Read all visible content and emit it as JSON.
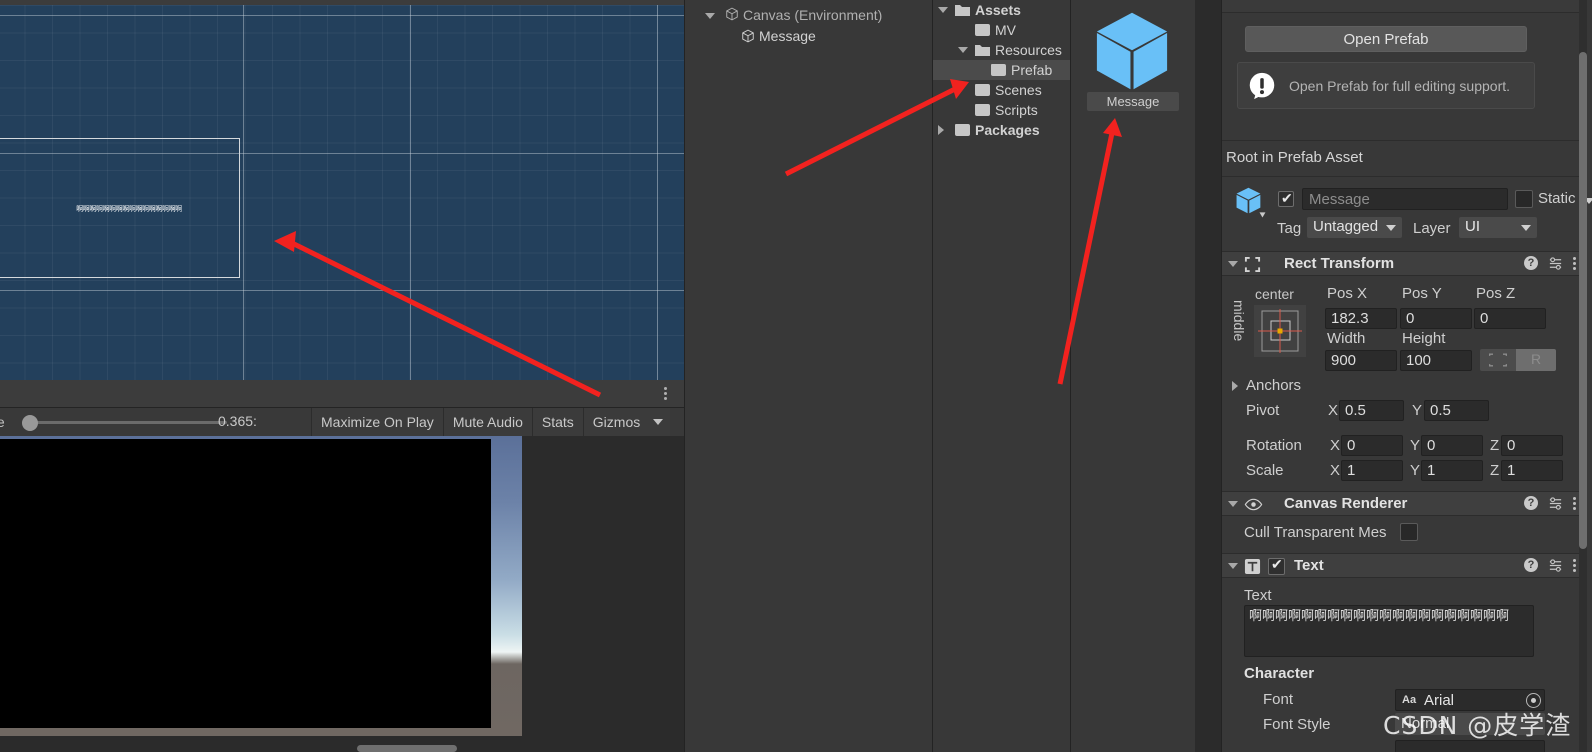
{
  "scene_view": {
    "canvas_text": "啊啊啊啊啊啊啊啊啊啊啊啊啊啊啊啊"
  },
  "game_toolbar": {
    "scale_label": "ale",
    "scale_value": "0.365:",
    "maximize_on_play": "Maximize On Play",
    "mute_audio": "Mute Audio",
    "stats": "Stats",
    "gizmos": "Gizmos"
  },
  "hierarchy": {
    "items": [
      {
        "label": "Canvas (Environment)",
        "icon": "cube-outline-icon"
      },
      {
        "label": "Message",
        "icon": "cube-outline-icon"
      }
    ]
  },
  "project": {
    "items": [
      {
        "label": "Assets",
        "icon": "folder-open-icon",
        "bold": true,
        "indent": 22,
        "expanded": true,
        "selected": false
      },
      {
        "label": "MV",
        "icon": "folder-icon",
        "bold": false,
        "indent": 42,
        "expanded": null,
        "selected": false
      },
      {
        "label": "Resources",
        "icon": "folder-open-icon",
        "bold": false,
        "indent": 42,
        "expanded": true,
        "selected": false
      },
      {
        "label": "Prefab",
        "icon": "folder-icon",
        "bold": false,
        "indent": 58,
        "expanded": null,
        "selected": true
      },
      {
        "label": "Scenes",
        "icon": "folder-icon",
        "bold": false,
        "indent": 42,
        "expanded": null,
        "selected": false
      },
      {
        "label": "Scripts",
        "icon": "folder-icon",
        "bold": false,
        "indent": 42,
        "expanded": null,
        "selected": false
      },
      {
        "label": "Packages",
        "icon": "folder-icon",
        "bold": true,
        "indent": 22,
        "expanded": false,
        "selected": false
      }
    ]
  },
  "preview": {
    "asset_name": "Message",
    "icon": "prefab-cube-icon"
  },
  "inspector": {
    "open_prefab_button": "Open Prefab",
    "prefab_help": "Open Prefab for full editing support.",
    "root_label": "Root in Prefab Asset",
    "game_object": {
      "name_placeholder": "Message",
      "static_label": "Static",
      "tag_label": "Tag",
      "tag_value": "Untagged",
      "layer_label": "Layer",
      "layer_value": "UI"
    },
    "rect_transform": {
      "title": "Rect Transform",
      "anchor_h": "center",
      "anchor_v": "middle",
      "pos_x_label": "Pos X",
      "pos_x": "182.3",
      "pos_y_label": "Pos Y",
      "pos_y": "0",
      "pos_z_label": "Pos Z",
      "pos_z": "0",
      "width_label": "Width",
      "width": "900",
      "height_label": "Height",
      "height": "100",
      "raw_button": "R",
      "anchors_label": "Anchors",
      "pivot_label": "Pivot",
      "pivot_x": "0.5",
      "pivot_y": "0.5",
      "rotation_label": "Rotation",
      "rot_x": "0",
      "rot_y": "0",
      "rot_z": "0",
      "scale_label": "Scale",
      "scale_x": "1",
      "scale_y": "1",
      "scale_z": "1",
      "axis_x": "X",
      "axis_y": "Y",
      "axis_z": "Z"
    },
    "canvas_renderer": {
      "title": "Canvas Renderer",
      "cull_label": "Cull Transparent Mes"
    },
    "text_component": {
      "title": "Text",
      "text_label": "Text",
      "text_value": "啊啊啊啊啊啊啊啊啊啊啊啊啊啊啊啊啊啊啊啊",
      "character_label": "Character",
      "font_label": "Font",
      "font_value": "Arial",
      "font_style_label": "Font Style",
      "font_style_value": "Normal"
    }
  },
  "watermark": "CSDN @皮学渣",
  "colors": {
    "scene_bg": "#23405c",
    "panel_bg": "#383838",
    "arrow_red": "#f2221f",
    "prefab_blue": "#69c0f7",
    "accent_orange": "#e8a800"
  }
}
